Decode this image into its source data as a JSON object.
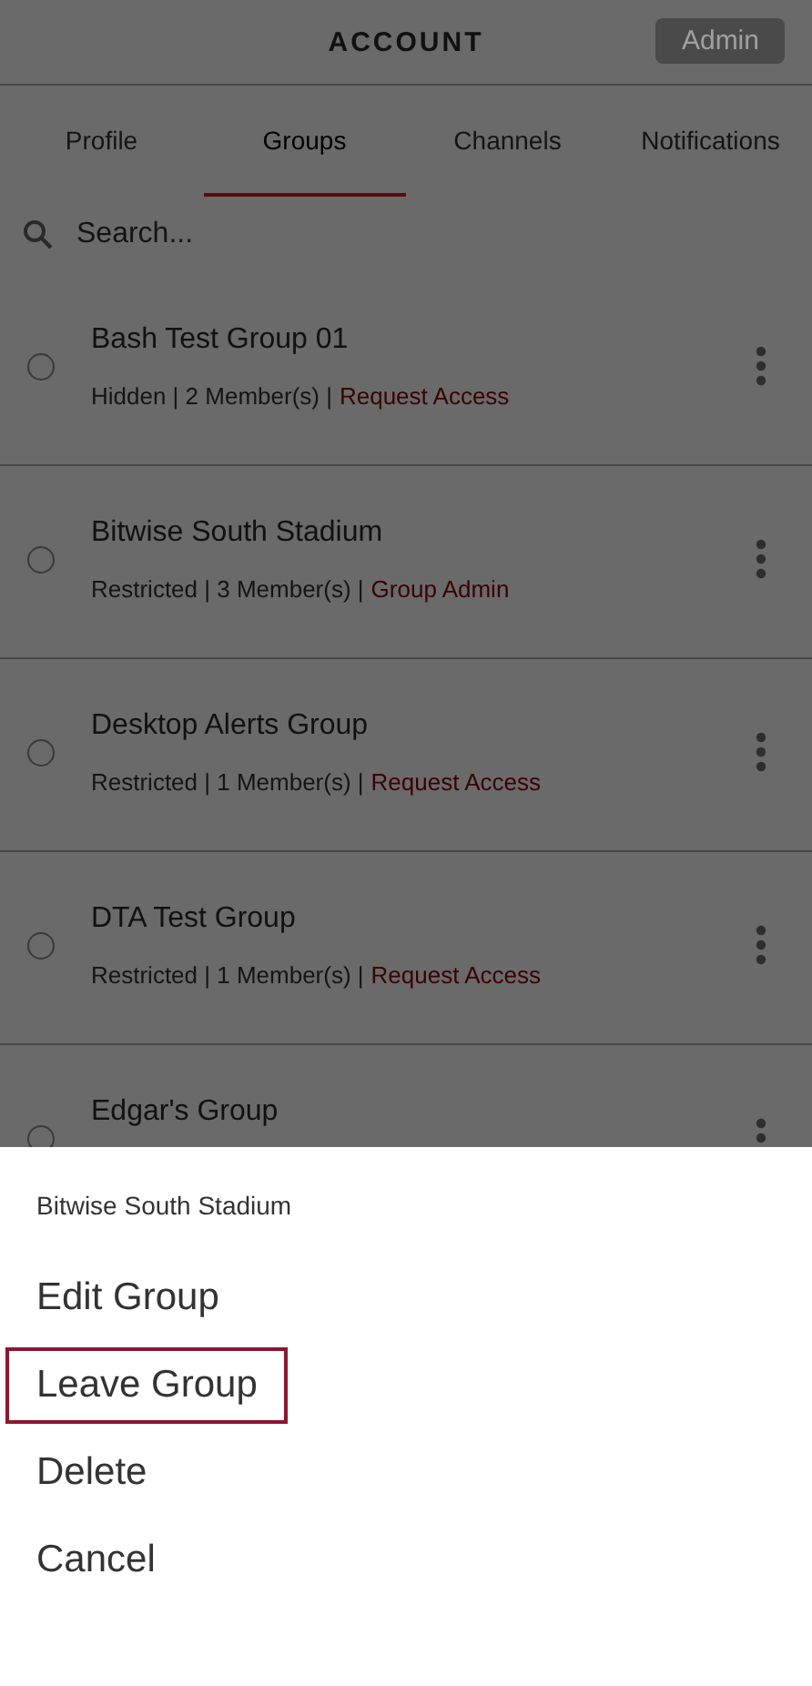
{
  "header": {
    "title": "ACCOUNT",
    "admin_button": "Admin"
  },
  "tabs": [
    {
      "label": "Profile",
      "selected": false
    },
    {
      "label": "Groups",
      "selected": true
    },
    {
      "label": "Channels",
      "selected": false
    },
    {
      "label": "Notifications",
      "selected": false
    }
  ],
  "search": {
    "placeholder": "Search..."
  },
  "groups": [
    {
      "name": "Bash Test Group 01",
      "selected": false,
      "details": "Hidden | 2 Member(s) |",
      "action": "Request Access"
    },
    {
      "name": "Bitwise South Stadium",
      "selected": false,
      "details": "Restricted | 3 Member(s) |",
      "action": "Group Admin"
    },
    {
      "name": "Desktop Alerts Group",
      "selected": false,
      "details": "Restricted | 1 Member(s) |",
      "action": "Request Access"
    },
    {
      "name": "DTA Test Group",
      "selected": false,
      "details": "Restricted | 1 Member(s) |",
      "action": "Request Access"
    },
    {
      "name": "Edgar's Group",
      "selected": false
    }
  ],
  "action_sheet": {
    "title": "Bitwise South Stadium",
    "options": [
      {
        "label": "Edit Group",
        "highlighted": false
      },
      {
        "label": "Leave Group",
        "highlighted": true
      },
      {
        "label": "Delete",
        "highlighted": false
      },
      {
        "label": "Cancel",
        "highlighted": false
      }
    ]
  }
}
